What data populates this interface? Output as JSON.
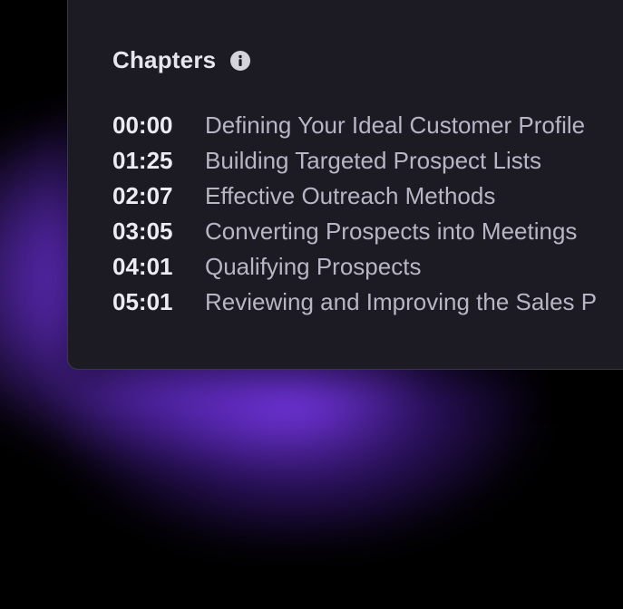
{
  "card": {
    "title": "Chapters"
  },
  "icons": {
    "info": "info-icon"
  },
  "colors": {
    "card_background": "#1c1b24",
    "glow": "#8c46ff",
    "timestamp": "#eceaf2",
    "chapter_title": "#b8b6c4"
  },
  "chapters": [
    {
      "time": "00:00",
      "title": "Defining Your Ideal Customer Profile"
    },
    {
      "time": "01:25",
      "title": "Building Targeted Prospect Lists"
    },
    {
      "time": "02:07",
      "title": "Effective Outreach Methods"
    },
    {
      "time": "03:05",
      "title": "Converting Prospects into Meetings"
    },
    {
      "time": "04:01",
      "title": "Qualifying Prospects"
    },
    {
      "time": "05:01",
      "title": "Reviewing and Improving the Sales P"
    }
  ]
}
